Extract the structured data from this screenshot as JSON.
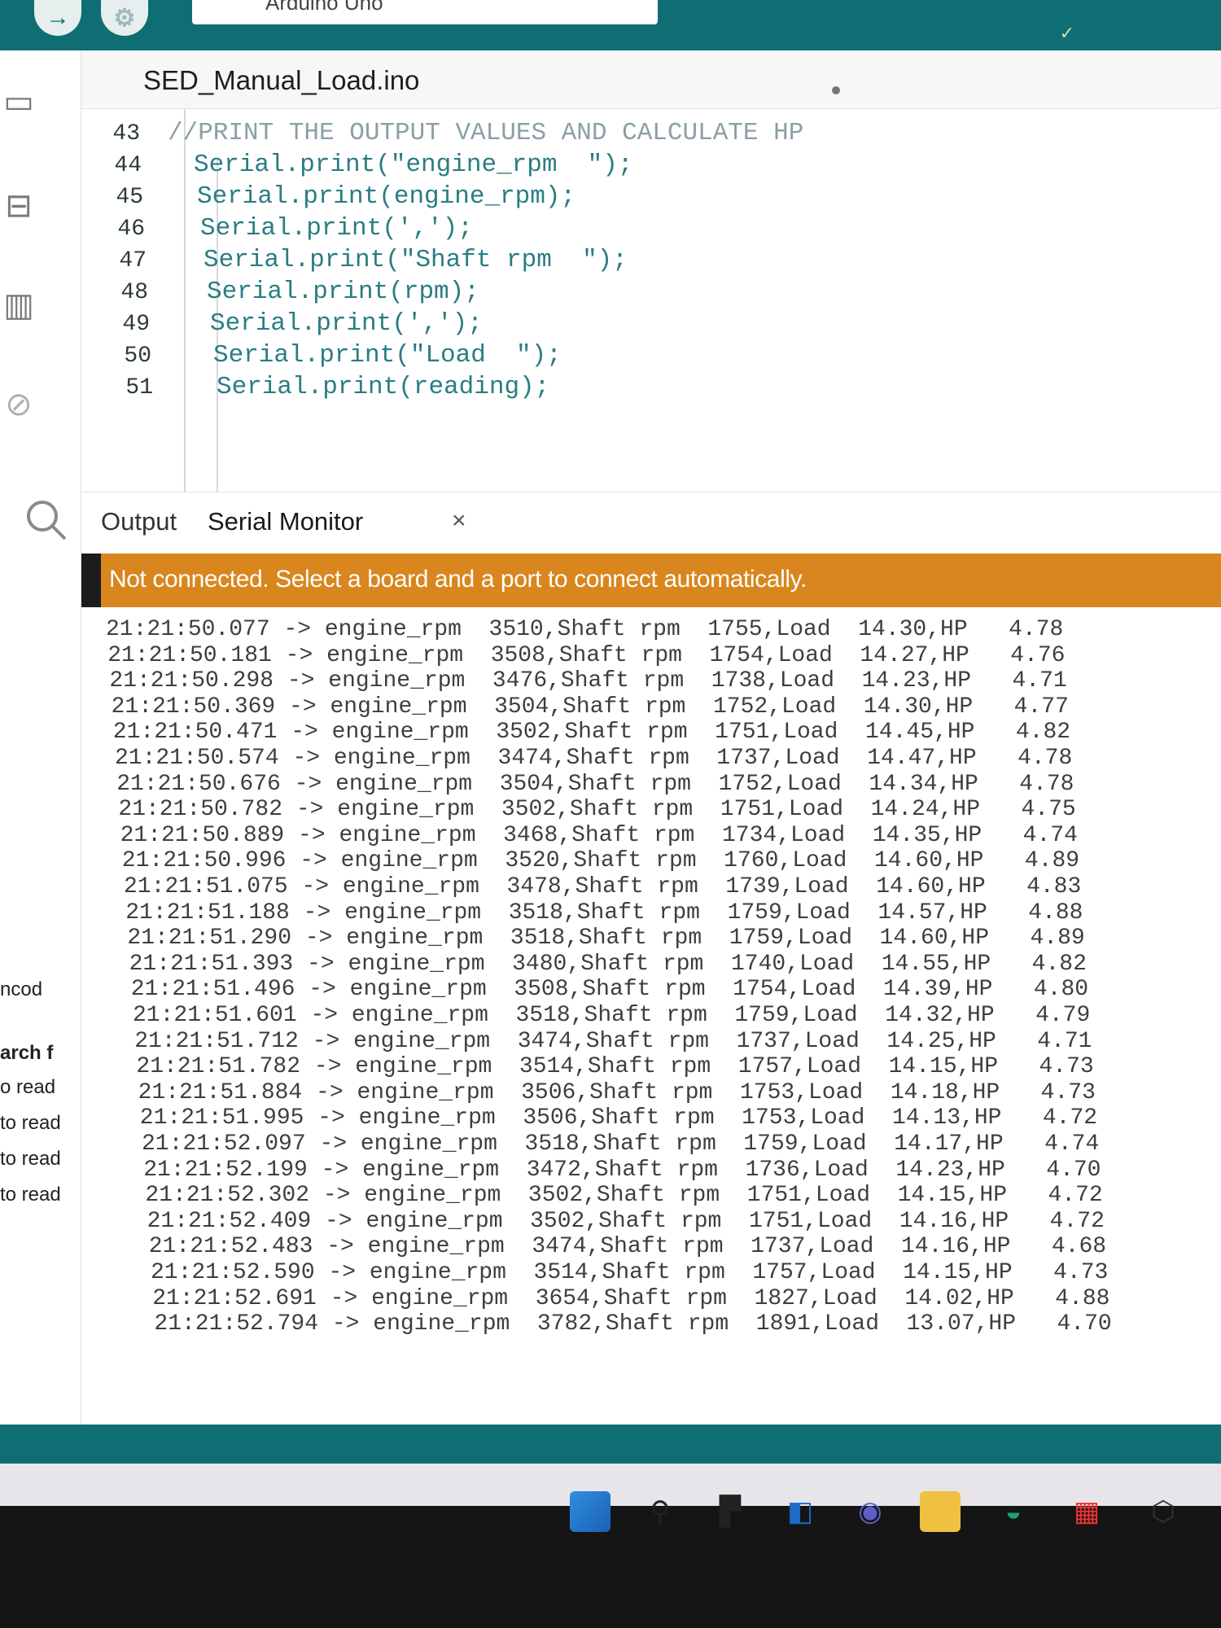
{
  "window": {
    "board_label": "Arduino Uno",
    "file_tab": "SED_Manual_Load.ino"
  },
  "sidebar": {
    "peek": [
      "ncod",
      "arch f",
      "o read",
      "to read",
      "to read",
      "to read"
    ]
  },
  "editor": {
    "lines": [
      {
        "num": "43",
        "code": "//PRINT THE OUTPUT VALUES AND CALCULATE HP"
      },
      {
        "num": "44",
        "code": "Serial.print(\"engine_rpm  \");"
      },
      {
        "num": "45",
        "code": "Serial.print(engine_rpm);"
      },
      {
        "num": "46",
        "code": "Serial.print(',');"
      },
      {
        "num": "47",
        "code": "Serial.print(\"Shaft rpm  \");"
      },
      {
        "num": "48",
        "code": "Serial.print(rpm);"
      },
      {
        "num": "49",
        "code": "Serial.print(',');"
      },
      {
        "num": "50",
        "code": "Serial.print(\"Load  \");"
      },
      {
        "num": "51",
        "code": "Serial.print(reading);"
      }
    ]
  },
  "panel": {
    "output_tab": "Output",
    "serial_tab": "Serial Monitor",
    "close_glyph": "×",
    "banner": "Not connected. Select a board and a port to connect automatically."
  },
  "serial_log": [
    {
      "time": "21:21:50.077",
      "engine": "3510",
      "shaft": "1755",
      "load": "14.30",
      "hp": "4.78"
    },
    {
      "time": "21:21:50.181",
      "engine": "3508",
      "shaft": "1754",
      "load": "14.27",
      "hp": "4.76"
    },
    {
      "time": "21:21:50.298",
      "engine": "3476",
      "shaft": "1738",
      "load": "14.23",
      "hp": "4.71"
    },
    {
      "time": "21:21:50.369",
      "engine": "3504",
      "shaft": "1752",
      "load": "14.30",
      "hp": "4.77"
    },
    {
      "time": "21:21:50.471",
      "engine": "3502",
      "shaft": "1751",
      "load": "14.45",
      "hp": "4.82"
    },
    {
      "time": "21:21:50.574",
      "engine": "3474",
      "shaft": "1737",
      "load": "14.47",
      "hp": "4.78"
    },
    {
      "time": "21:21:50.676",
      "engine": "3504",
      "shaft": "1752",
      "load": "14.34",
      "hp": "4.78"
    },
    {
      "time": "21:21:50.782",
      "engine": "3502",
      "shaft": "1751",
      "load": "14.24",
      "hp": "4.75"
    },
    {
      "time": "21:21:50.889",
      "engine": "3468",
      "shaft": "1734",
      "load": "14.35",
      "hp": "4.74"
    },
    {
      "time": "21:21:50.996",
      "engine": "3520",
      "shaft": "1760",
      "load": "14.60",
      "hp": "4.89"
    },
    {
      "time": "21:21:51.075",
      "engine": "3478",
      "shaft": "1739",
      "load": "14.60",
      "hp": "4.83"
    },
    {
      "time": "21:21:51.188",
      "engine": "3518",
      "shaft": "1759",
      "load": "14.57",
      "hp": "4.88"
    },
    {
      "time": "21:21:51.290",
      "engine": "3518",
      "shaft": "1759",
      "load": "14.60",
      "hp": "4.89"
    },
    {
      "time": "21:21:51.393",
      "engine": "3480",
      "shaft": "1740",
      "load": "14.55",
      "hp": "4.82"
    },
    {
      "time": "21:21:51.496",
      "engine": "3508",
      "shaft": "1754",
      "load": "14.39",
      "hp": "4.80"
    },
    {
      "time": "21:21:51.601",
      "engine": "3518",
      "shaft": "1759",
      "load": "14.32",
      "hp": "4.79"
    },
    {
      "time": "21:21:51.712",
      "engine": "3474",
      "shaft": "1737",
      "load": "14.25",
      "hp": "4.71"
    },
    {
      "time": "21:21:51.782",
      "engine": "3514",
      "shaft": "1757",
      "load": "14.15",
      "hp": "4.73"
    },
    {
      "time": "21:21:51.884",
      "engine": "3506",
      "shaft": "1753",
      "load": "14.18",
      "hp": "4.73"
    },
    {
      "time": "21:21:51.995",
      "engine": "3506",
      "shaft": "1753",
      "load": "14.13",
      "hp": "4.72"
    },
    {
      "time": "21:21:52.097",
      "engine": "3518",
      "shaft": "1759",
      "load": "14.17",
      "hp": "4.74"
    },
    {
      "time": "21:21:52.199",
      "engine": "3472",
      "shaft": "1736",
      "load": "14.23",
      "hp": "4.70"
    },
    {
      "time": "21:21:52.302",
      "engine": "3502",
      "shaft": "1751",
      "load": "14.15",
      "hp": "4.72"
    },
    {
      "time": "21:21:52.409",
      "engine": "3502",
      "shaft": "1751",
      "load": "14.16",
      "hp": "4.72"
    },
    {
      "time": "21:21:52.483",
      "engine": "3474",
      "shaft": "1737",
      "load": "14.16",
      "hp": "4.68"
    },
    {
      "time": "21:21:52.590",
      "engine": "3514",
      "shaft": "1757",
      "load": "14.15",
      "hp": "4.73"
    },
    {
      "time": "21:21:52.691",
      "engine": "3654",
      "shaft": "1827",
      "load": "14.02",
      "hp": "4.88"
    },
    {
      "time": "21:21:52.794",
      "engine": "3782",
      "shaft": "1891",
      "load": "13.07",
      "hp": "4.70"
    }
  ],
  "log_format": {
    "arrow": "->",
    "engine_label": "engine_rpm",
    "shaft_label": ",Shaft rpm",
    "load_label": ",Load",
    "hp_label": ",HP"
  },
  "taskbar": {
    "icons": [
      "windows-start-icon",
      "search-icon",
      "task-view-icon",
      "widgets-icon",
      "teams-chat-icon",
      "file-explorer-icon",
      "edge-browser-icon",
      "store-icon",
      "arduino-ide-icon"
    ]
  },
  "colors": {
    "accent": "#0f6e73",
    "banner": "#d9861e",
    "code": "#2a7d82",
    "comment": "#8aa0a4"
  }
}
